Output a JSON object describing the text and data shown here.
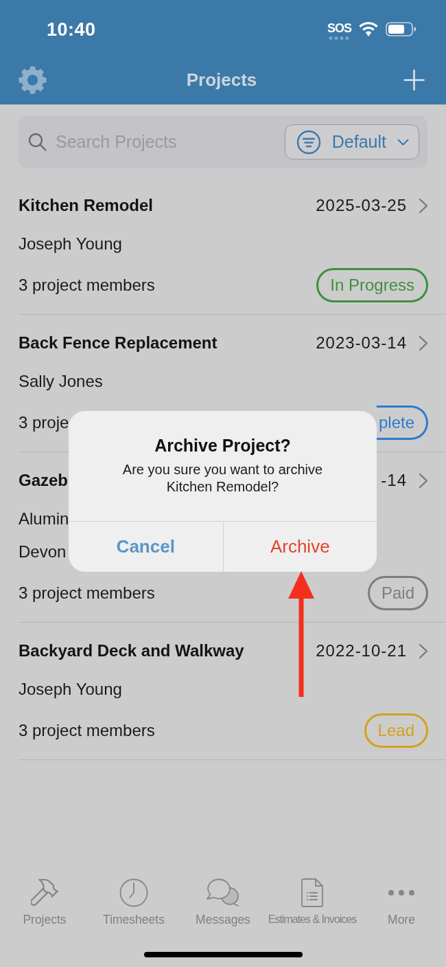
{
  "status_bar": {
    "time": "10:40",
    "network": "SOS"
  },
  "nav_bar": {
    "title": "Projects"
  },
  "search": {
    "placeholder": "Search Projects",
    "sort": {
      "label": "Default"
    }
  },
  "projects": [
    {
      "title": "Kitchen Remodel",
      "date": "2025-03-25",
      "details": [
        "Joseph Young"
      ],
      "members": "3 project members",
      "status": {
        "label": "In Progress",
        "color": "#3f8f3f",
        "clipped": false
      }
    },
    {
      "title": "Back Fence Replacement",
      "date": "2023-03-14",
      "details": [
        "Sally Jones"
      ],
      "members": "3 proje",
      "status": {
        "label": "plete",
        "color": "#2a7cd0",
        "clipped": true
      }
    },
    {
      "title": "Gazeb",
      "date": "-14",
      "details": [
        "Alumin",
        "Devon"
      ],
      "members": "3 project members",
      "status": {
        "label": "Paid",
        "color": "#7d7d7d",
        "clipped": false
      }
    },
    {
      "title": "Backyard Deck and Walkway",
      "date": "2022-10-21",
      "details": [
        "Joseph Young"
      ],
      "members": "3 project members",
      "status": {
        "label": "Lead",
        "color": "#d3a11c",
        "clipped": false
      }
    }
  ],
  "dialog": {
    "title": "Archive Project?",
    "message": "Are you sure you want to archive Kitchen Remodel?",
    "buttons": [
      {
        "label": "Cancel",
        "kind": "cancel"
      },
      {
        "label": "Archive",
        "kind": "destructive"
      }
    ]
  },
  "tab_bar": [
    {
      "label": "Projects",
      "selected": false
    },
    {
      "label": "Timesheets",
      "selected": false
    },
    {
      "label": "Messages",
      "selected": false
    },
    {
      "label": "Estimates & Invoices",
      "selected": false
    },
    {
      "label": "More",
      "selected": false
    }
  ]
}
